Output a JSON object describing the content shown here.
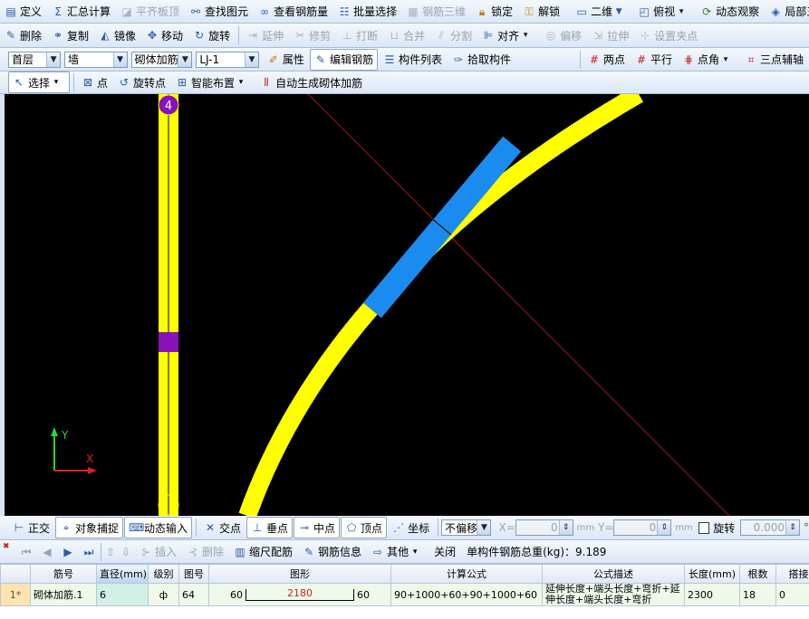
{
  "menu": {
    "define": "定义",
    "sum_calc": "汇总计算",
    "flat_slab": "平齐板顶",
    "find_element": "查找图元",
    "view_rebar_qty": "查看钢筋量",
    "batch_select": "批量选择",
    "rebar_3d": "钢筋三维",
    "lock": "锁定",
    "unlock": "解锁",
    "view_mode": "二维",
    "top_view": "俯视",
    "dynamic_observe": "动态观察",
    "partial": "局部三"
  },
  "edit": {
    "delete": "删除",
    "copy": "复制",
    "mirror": "镜像",
    "move": "移动",
    "rotate": "旋转",
    "extend": "延伸",
    "trim": "修剪",
    "break": "打断",
    "merge": "合并",
    "split": "分割",
    "align": "对齐",
    "offset": "偏移",
    "stretch": "拉伸",
    "set_grip": "设置夹点"
  },
  "props": {
    "floor": "首层",
    "category": "墙",
    "type": "砌体加筋",
    "name": "LJ-1",
    "attributes": "属性",
    "edit_rebar": "编辑钢筋",
    "component_list": "构件列表",
    "pick_component": "拾取构件",
    "two_points": "两点",
    "parallel": "平行",
    "point_angle": "点角",
    "three_point_aux": "三点辅轴"
  },
  "draw": {
    "select": "选择",
    "point": "点",
    "rotate_point": "旋转点",
    "smart_layout": "智能布置",
    "auto_generate": "自动生成砌体加筋"
  },
  "canvas": {
    "axis_label": "4",
    "y_label": "Y",
    "x_label": "X"
  },
  "snap": {
    "ortho": "正交",
    "object_snap": "对象捕捉",
    "dynamic_input": "动态输入",
    "intersection": "交点",
    "perpendicular": "垂点",
    "midpoint": "中点",
    "vertex": "顶点",
    "coordinate": "坐标",
    "offset_mode": "不偏移",
    "x_label": "X=",
    "x_value": "0",
    "y_label": "Y=",
    "y_value": "0",
    "unit": "mm",
    "rotate": "旋转",
    "rotate_value": "0.000",
    "degree": "°"
  },
  "rebar_toolbar": {
    "insert": "插入",
    "delete": "删除",
    "scale_rebar": "缩尺配筋",
    "rebar_info": "钢筋信息",
    "other": "其他",
    "close": "关闭",
    "total_weight_label": "单构件钢筋总重(kg)：9.189"
  },
  "table": {
    "headers": [
      "筋号",
      "直径(mm)",
      "级别",
      "图号",
      "图形",
      "计算公式",
      "公式描述",
      "长度(mm)",
      "根数",
      "搭接"
    ],
    "rows": [
      {
        "index": "1*",
        "name": "砌体加筋.1",
        "diameter": "6",
        "grade": "ф",
        "figure_no": "64",
        "shape_left": "60",
        "shape_mid": "2180",
        "shape_right": "60",
        "formula": "90+1000+60+90+1000+60",
        "description": "延伸长度+端头长度+弯折+延伸长度+端头长度+弯折",
        "length": "2300",
        "count": "18",
        "lap": "0"
      }
    ]
  },
  "colors": {
    "canvas_bg": "#000000",
    "wall": "#ffff00",
    "rebar_element": "#1a8cf0",
    "column_marker": "#8a10b8",
    "axis_line": "#b01010"
  }
}
